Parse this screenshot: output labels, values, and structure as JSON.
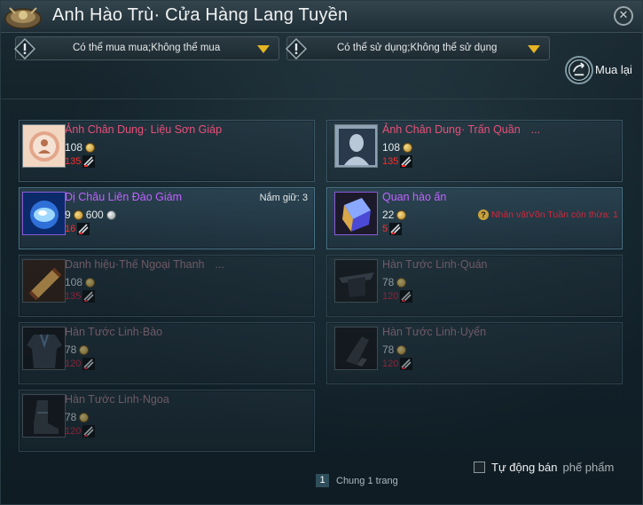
{
  "window": {
    "title": "Anh Hào Trù· Cửa Hàng Lang Tuyền",
    "close_icon": "close-icon"
  },
  "filters": {
    "buy": "Có thể mua mua;Không thể mua",
    "use": "Có thể sử dụng;Không thể sử dụng"
  },
  "buyback": {
    "label": "Mua lại"
  },
  "colors": {
    "name_pink": "#e85078",
    "name_violet": "#c063ff",
    "stock_red": "#ff2b2b",
    "dropdown_arrow": "#e6b522"
  },
  "items": [
    {
      "name": "Ảnh Chân Dung· Liệu Sơn Giáp",
      "price": "108",
      "stock": "135",
      "icon": "portrait-icon"
    },
    {
      "name": "Ảnh Chân Dung· Trấn Quần",
      "ellipsis": "...",
      "price": "108",
      "stock": "135",
      "icon": "portrait-silhouette-icon"
    },
    {
      "name": "Dị Châu Liên Đào Giám",
      "price": "9",
      "price2": "600",
      "stock": "16",
      "holdings": "Nắm giữ: 3",
      "icon": "gem-icon"
    },
    {
      "name": "Quan hào ấn",
      "price": "22",
      "stock": "5",
      "remain": "Nhân vậtVõn Tuần còn thừa: 1",
      "icon": "seal-icon"
    },
    {
      "name": "Danh hiệu·Thế Ngoại Thanh",
      "ellipsis": "...",
      "price": "108",
      "stock": "135",
      "icon": "scroll-icon"
    },
    {
      "name": "Hàn Tước Linh·Quán",
      "price": "78",
      "stock": "120",
      "icon": "hat-icon"
    },
    {
      "name": "Hàn Tước Linh·Bào",
      "price": "78",
      "stock": "120",
      "icon": "robe-icon"
    },
    {
      "name": "Hàn Tước Linh·Uyển",
      "price": "78",
      "stock": "120",
      "icon": "glove-icon"
    },
    {
      "name": "Hàn Tước Linh·Ngoa",
      "price": "78",
      "stock": "120",
      "icon": "boot-icon"
    }
  ],
  "auto_sell": {
    "label": "Tự động bán",
    "label2": "phế phẩm"
  },
  "pager": {
    "page": "1",
    "text": "Chung 1 trang"
  }
}
